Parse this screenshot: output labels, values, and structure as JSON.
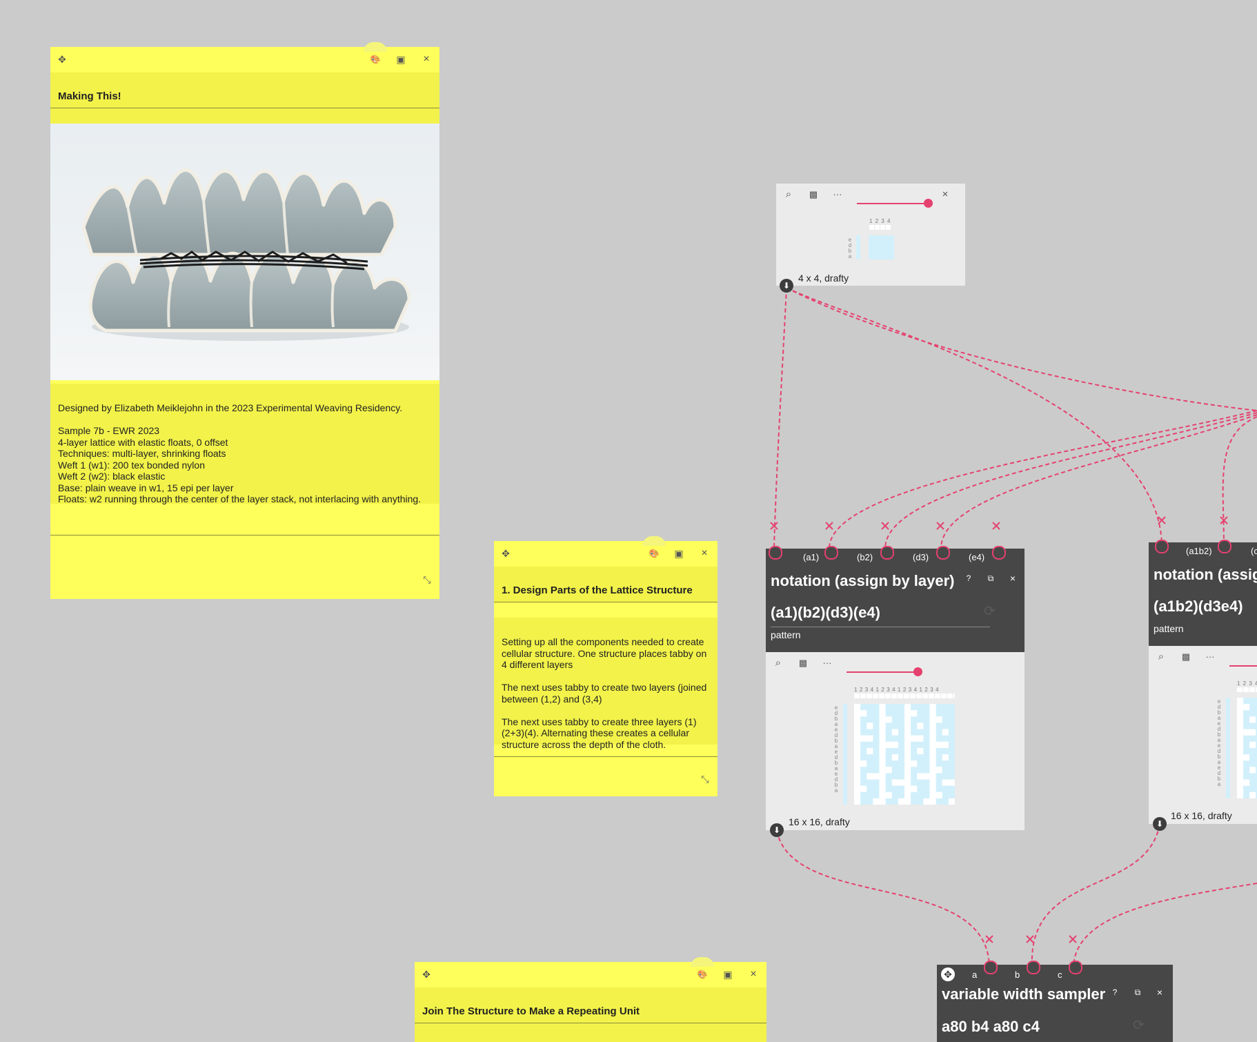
{
  "notes": {
    "making": {
      "title": "Making This!",
      "body": "Designed by Elizabeth Meiklejohn in the 2023 Experimental Weaving Residency.\n\nSample 7b - EWR 2023\n4-layer lattice with elastic floats, 0 offset\nTechniques: multi-layer, shrinking floats\nWeft 1 (w1): 200 tex bonded nylon\nWeft 2 (w2): black elastic\nBase: plain weave in w1, 15 epi per layer\nFloats: w2 running through the center of the layer stack, not interlacing with anything."
    },
    "design": {
      "title": "1. Design Parts of the Lattice Structure",
      "body": "Setting up all the components needed to create cellular structure. One structure places tabby on 4 different layers\n\nThe next uses tabby to create two layers (joined between (1,2) and (3,4)\n\nThe next uses tabby to create three layers (1)(2+3)(4). Alternating these creates a cellular structure across the depth of the cloth."
    },
    "join": {
      "title": "Join The Structure to Make a Repeating Unit"
    }
  },
  "icons": {
    "move": "✥",
    "palette": "🎨",
    "image": "▣",
    "close": "×",
    "resize": "⤡",
    "search": "⌕",
    "checker": "▩",
    "more": "···",
    "help": "?",
    "duplicate": "⧉",
    "refresh": "⟳",
    "download": "⬇",
    "cut": "×"
  },
  "drafts": {
    "top": {
      "label": "4 x 4, drafty",
      "ticks": "1 2 3 4",
      "rows": "e\nd\nb\na"
    },
    "notation1": {
      "label": "16 x 16, drafty",
      "ticks": "1 2 3 4 1 2 3 4 1 2 3 4 1 2 3 4",
      "rows": "e\nd\nb\na\ne\nd\nb\na\ne\nd\nb\na\ne\nd\nb\na"
    },
    "notation2": {
      "label": "16 x 16, drafty",
      "ticks": "1 2 3 4",
      "rows": "e\nd\nb\na\ne\nd\nb\na\ne\nd\nb\na\ne\nd\nb\na"
    }
  },
  "ops": {
    "notation1": {
      "title": "notation (assign by layer)",
      "value": "(a1)(b2)(d3)(e4)",
      "param_label": "pattern",
      "inlets": [
        "(a1)",
        "(b2)",
        "(d3)",
        "(e4)"
      ]
    },
    "notation2": {
      "title": "notation (assig",
      "value": "(a1b2)(d3e4)",
      "param_label": "pattern",
      "inlets": [
        "(a1b2)",
        "(c"
      ]
    },
    "sampler": {
      "title": "variable width sampler",
      "value": "a80 b4 a80 c4",
      "inlets": [
        "a",
        "b",
        "c"
      ]
    }
  },
  "colors": {
    "background": "#cbcbcb",
    "note": "#feff5a",
    "operation": "#474747",
    "connection": "#e5416f",
    "draft_cell": "#d2f0fb"
  }
}
